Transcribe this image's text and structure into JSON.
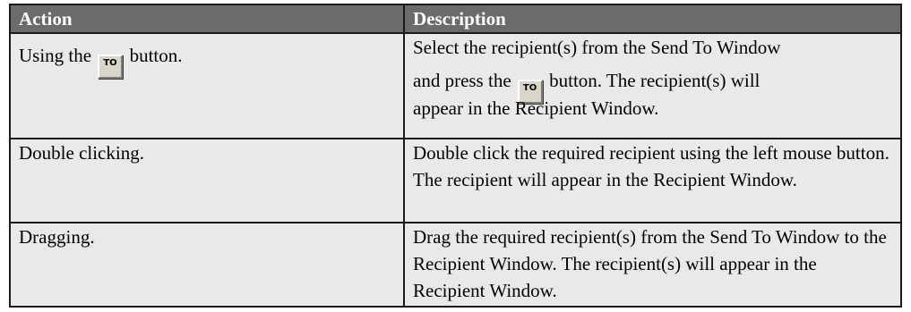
{
  "table": {
    "headers": [
      "Action",
      "Description"
    ],
    "button_label": "TO",
    "rows": [
      {
        "action_pre": "Using the",
        "action_post": "button.",
        "desc_line1": "Select the recipient(s) from the Send To Window",
        "desc_pre": "and press the",
        "desc_post": "button. The recipient(s) will",
        "desc_line3": "appear in the Recipient Window."
      },
      {
        "action": "Double clicking.",
        "description": "Double click the required recipient using the left mouse button. The recipient will appear in the Recipient Window."
      },
      {
        "action": "Dragging.",
        "description": "Drag the required recipient(s) from the Send To Window to the Recipient Window. The recipient(s) will appear in the Recipient Window."
      }
    ]
  }
}
